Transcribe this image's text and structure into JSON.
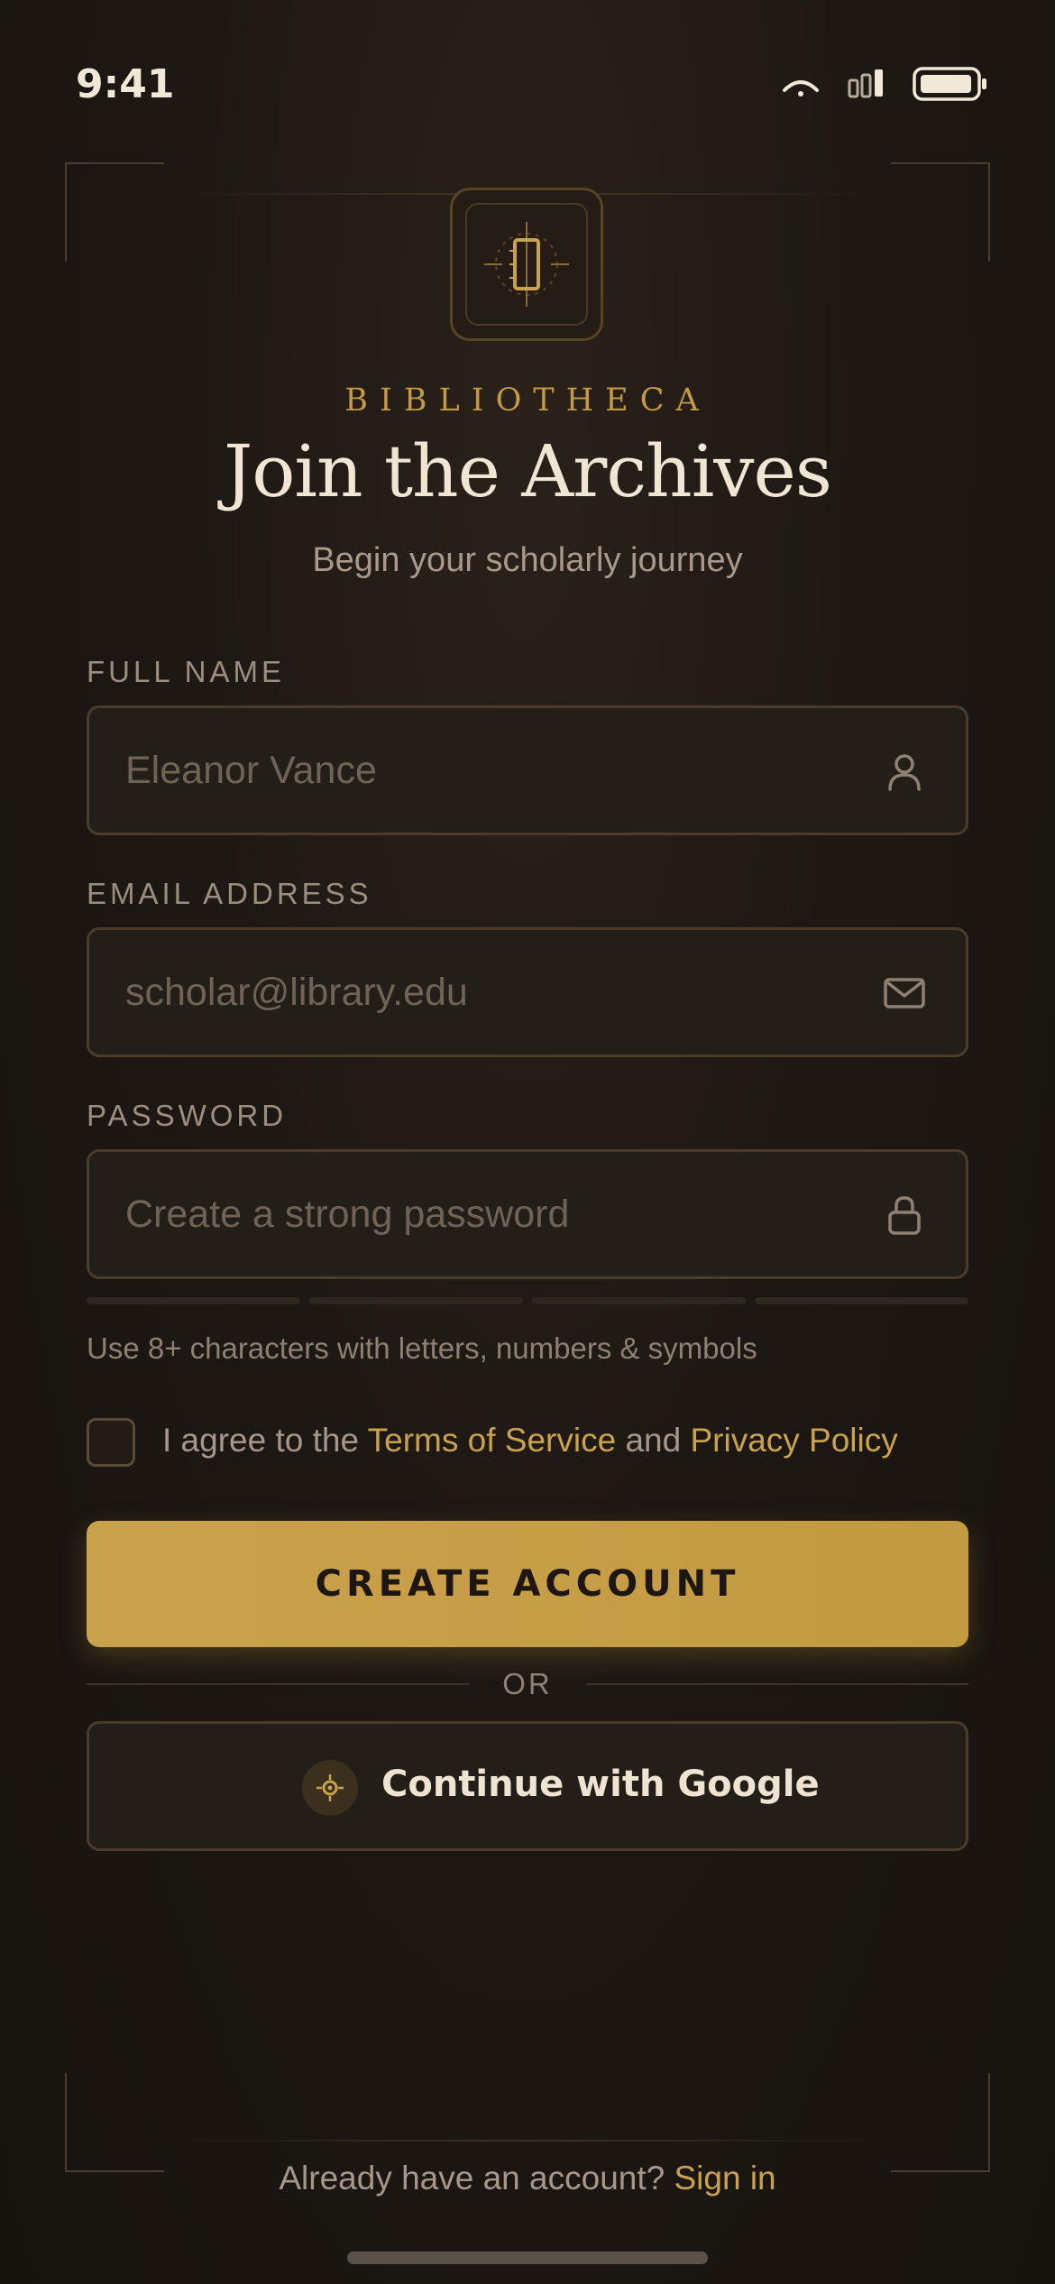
{
  "status_bar": {
    "time": "9:41"
  },
  "header": {
    "brand": "BIBLIOTHECA",
    "title": "Join the Archives",
    "subtitle": "Begin your scholarly journey"
  },
  "form": {
    "full_name": {
      "label": "FULL NAME",
      "placeholder": "Eleanor Vance",
      "value": "",
      "icon": "user-icon"
    },
    "email": {
      "label": "EMAIL ADDRESS",
      "placeholder": "scholar@library.edu",
      "value": "",
      "icon": "mail-icon"
    },
    "password": {
      "label": "PASSWORD",
      "placeholder": "Create a strong password",
      "value": "",
      "icon": "lock-icon"
    },
    "password_strength_segments": 4,
    "password_strength_filled": 0,
    "password_hint": "Use 8+ characters with letters, numbers & symbols",
    "agreement": {
      "checked": false,
      "prefix": "I agree to the ",
      "terms": "Terms of Service",
      "middle": " and ",
      "privacy": "Privacy Policy"
    }
  },
  "actions": {
    "create_account": "CREATE ACCOUNT",
    "divider": "OR",
    "google": "Continue with Google"
  },
  "footer": {
    "prompt": "Already have an account? ",
    "signin": "Sign in"
  },
  "colors": {
    "accent": "#c9a24f",
    "background": "#1e1814",
    "text": "#efe4d2"
  }
}
